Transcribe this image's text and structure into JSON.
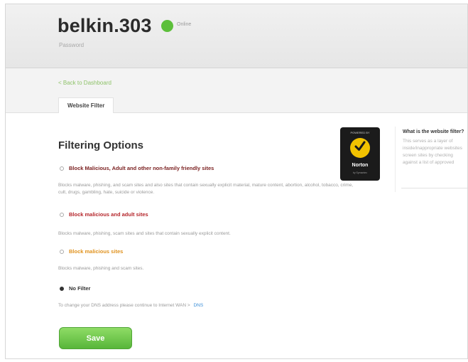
{
  "header": {
    "router_name": "belkin.303",
    "status_text": "Online",
    "password_label": "Password",
    "status_color": "#5cbf3a"
  },
  "nav": {
    "back_link": "< Back to Dashboard",
    "tab_label": "Website Filter"
  },
  "main": {
    "section_title": "Filtering Options",
    "options": [
      {
        "label": "Block Malicious, Adult and other non-family friendly sites",
        "description": "Blocks malware, phishing, and scam sites and also sites that contain sexually explicit material, mature content, abortion, alcohol, tobacco, crime, cult, drugs, gambling, hate, suicide or violence.",
        "color": "#7a1f1f",
        "selected": false
      },
      {
        "label": "Block malicious and adult sites",
        "description": "Blocks malware, phishing, scam sites and sites that contain sexually explicit content.",
        "color": "#b5262b",
        "selected": false
      },
      {
        "label": "Block malicious sites",
        "description": "Blocks malware, phishing and scam sites.",
        "color": "#e0921e",
        "selected": false
      },
      {
        "label": "No Filter",
        "description": "",
        "color": "#333333",
        "selected": true
      }
    ],
    "dns_text": "To change your DNS address please continue to Internet WAN >",
    "dns_link": "DNS",
    "save_button": "Save"
  },
  "badge": {
    "top_text": "POWERED BY",
    "brand": "Norton",
    "bottom_text": "by Symantec",
    "icon": "norton-check-icon"
  },
  "info": {
    "title": "What is the website filter?",
    "lines": [
      "This serves as a layer of",
      "inside/inappropriate websites",
      "screen sites by checking",
      "against a list of approved"
    ]
  }
}
